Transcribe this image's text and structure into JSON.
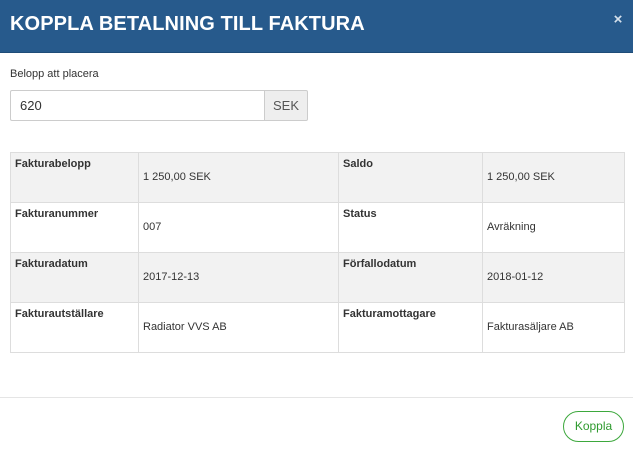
{
  "header": {
    "title": "KOPPLA BETALNING TILL FAKTURA",
    "close_glyph": "×"
  },
  "amount": {
    "label": "Belopp att placera",
    "value": "620",
    "currency": "SEK"
  },
  "details": {
    "rows": [
      {
        "label_1": "Fakturabelopp",
        "value_1": "1 250,00 SEK",
        "label_2": "Saldo",
        "value_2": "1 250,00 SEK"
      },
      {
        "label_1": "Fakturanummer",
        "value_1": "007",
        "label_2": "Status",
        "value_2": "Avräkning"
      },
      {
        "label_1": "Fakturadatum",
        "value_1": "2017-12-13",
        "label_2": "Förfallodatum",
        "value_2": "2018-01-12"
      },
      {
        "label_1": "Fakturautställare",
        "value_1": "Radiator VVS AB",
        "label_2": "Fakturamottagare",
        "value_2": "Fakturasäljare AB"
      }
    ]
  },
  "footer": {
    "submit_label": "Koppla"
  },
  "colors": {
    "header_bg": "#275a8c",
    "button_green": "#3da83d"
  }
}
